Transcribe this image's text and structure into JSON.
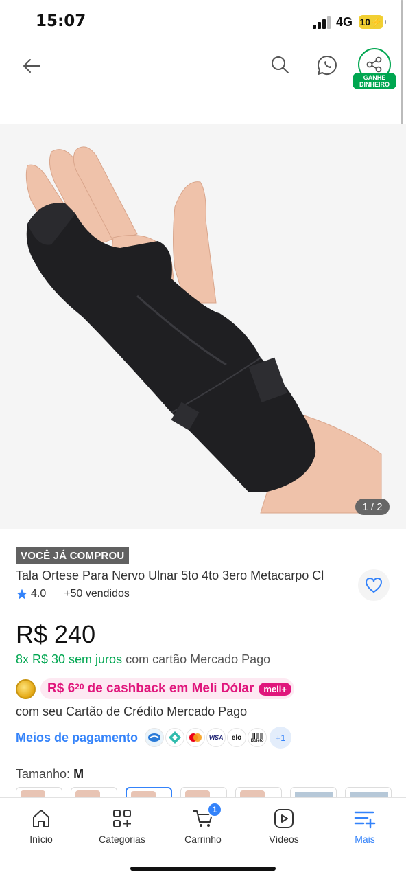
{
  "status_bar": {
    "time": "15:07",
    "network": "4G",
    "battery": "10"
  },
  "header": {
    "share_label_line1": "GANHE",
    "share_label_line2": "DINHEIRO"
  },
  "gallery": {
    "counter": "1 / 2",
    "current_image": 1,
    "total_images": 2
  },
  "product": {
    "bought_badge": "VOCÊ JÁ COMPROU",
    "title": "Tala Ortese Para Nervo Ulnar 5to 4to 3ero Metacarpo Cl",
    "rating": "4.0",
    "sold": "+50 vendidos",
    "price": "R$ 240",
    "installments_green": "8x R$ 30 sem juros",
    "installments_rest": " com cartão Mercado Pago"
  },
  "cashback": {
    "amount_main": "R$ 6",
    "amount_cents": "20",
    "text": "de cashback em Meli Dólar",
    "badge": "meli+",
    "subtitle": "com seu Cartão de Crédito Mercado Pago"
  },
  "payment": {
    "link": "Meios de pagamento",
    "logos": [
      "mercado-pago",
      "pix",
      "mastercard",
      "VISA",
      "elo",
      "Boleto"
    ],
    "more": "+1"
  },
  "variation": {
    "label": "Tamanho: ",
    "value": "M"
  },
  "tabbar": {
    "items": [
      {
        "label": "Início"
      },
      {
        "label": "Categorias"
      },
      {
        "label": "Carrinho",
        "badge": "1"
      },
      {
        "label": "Vídeos"
      },
      {
        "label": "Mais"
      }
    ]
  },
  "colors": {
    "accent_blue": "#3483fa",
    "green": "#00a650",
    "pink": "#e0167c"
  }
}
